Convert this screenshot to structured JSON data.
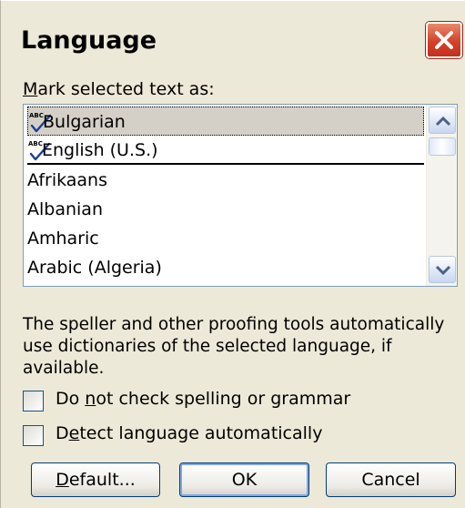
{
  "window": {
    "title": "Language"
  },
  "list": {
    "label_mnemonic": "M",
    "label_rest": "ark selected text as:",
    "items": [
      {
        "label": "Bulgarian",
        "icon": "spellcheck-icon",
        "selected": true
      },
      {
        "label": "English (U.S.)",
        "icon": "spellcheck-icon",
        "selected": false
      },
      {
        "label": "Afrikaans",
        "icon": "",
        "selected": false
      },
      {
        "label": "Albanian",
        "icon": "",
        "selected": false
      },
      {
        "label": "Amharic",
        "icon": "",
        "selected": false
      },
      {
        "label": "Arabic (Algeria)",
        "icon": "",
        "selected": false
      }
    ]
  },
  "info_text": "The speller and other proofing tools automatically use dictionaries of the selected language, if available.",
  "options": {
    "no_check_pre": "Do ",
    "no_check_mnemonic": "n",
    "no_check_post": "ot check spelling or grammar",
    "no_check_checked": false,
    "detect_pre": "D",
    "detect_mnemonic": "e",
    "detect_post": "tect language automatically",
    "detect_checked": false
  },
  "buttons": {
    "default_mnemonic": "D",
    "default_rest": "efault...",
    "ok": "OK",
    "cancel": "Cancel"
  },
  "colors": {
    "dialog_bg": "#ece9d8",
    "close_red": "#d4412a",
    "list_border": "#7f9db9",
    "selection_bg": "#d4d0c8"
  }
}
